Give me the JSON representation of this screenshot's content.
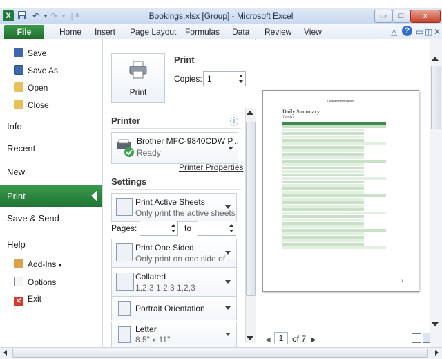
{
  "window": {
    "title": "Bookings.xlsx [Group] - Microsoft Excel",
    "quick_access": {
      "app_icon": "X",
      "save_icon": "floppy-icon",
      "undo_icon": "undo-icon",
      "redo_icon": "redo-icon",
      "customize_icon": "dropdown-icon"
    },
    "controls": {
      "minimize": "▭",
      "maximize": "□",
      "close": "x"
    }
  },
  "ribbon": {
    "tabs": [
      "File",
      "Home",
      "Insert",
      "Page Layout",
      "Formulas",
      "Data",
      "Review",
      "View"
    ],
    "right_icons": {
      "minimize_ribbon": "△",
      "help": "?",
      "min": "▭",
      "restore": "◫",
      "close": "✕"
    }
  },
  "backstage": {
    "nav": {
      "save": "Save",
      "save_as": "Save As",
      "open": "Open",
      "close": "Close",
      "info": "Info",
      "recent": "Recent",
      "new": "New",
      "print": "Print",
      "save_send": "Save & Send",
      "help": "Help",
      "add_ins": "Add-Ins",
      "add_ins_arrow": "▾",
      "options": "Options",
      "exit": "Exit"
    },
    "print": {
      "section_title": "Print",
      "print_button": "Print",
      "copies_label": "Copies:",
      "copies_value": "1"
    },
    "printer": {
      "section_title": "Printer",
      "info_icon": "ⓘ",
      "name": "Brother MFC-9840CDW P...",
      "status": "Ready",
      "properties_link": "Printer Properties"
    },
    "settings": {
      "section_title": "Settings",
      "what": {
        "title": "Print Active Sheets",
        "desc": "Only print the active sheets"
      },
      "pages_label": "Pages:",
      "to_label": "to",
      "sides": {
        "title": "Print One Sided",
        "desc": "Only print on one side of ..."
      },
      "collation": {
        "title": "Collated",
        "desc": "1,2,3   1,2,3   1,2,3"
      },
      "orientation": {
        "title": "Portrait Orientation"
      },
      "paper": {
        "title": "Letter",
        "desc": "8.5\" x 11\""
      }
    },
    "preview": {
      "current_page": "1",
      "total_pages": "of 7",
      "prev_icon": "◀",
      "next_icon": "▶",
      "page_header": "Tuesday Reservations",
      "doc_title": "Daily Summary",
      "doc_subtitle": "Tuesday",
      "page_number": "1"
    }
  },
  "colors": {
    "accent_green": "#217a35",
    "ribbon_blue": "#dfe9f5",
    "table_header": "#3f8a4a",
    "table_row": "#c9e1c6"
  }
}
